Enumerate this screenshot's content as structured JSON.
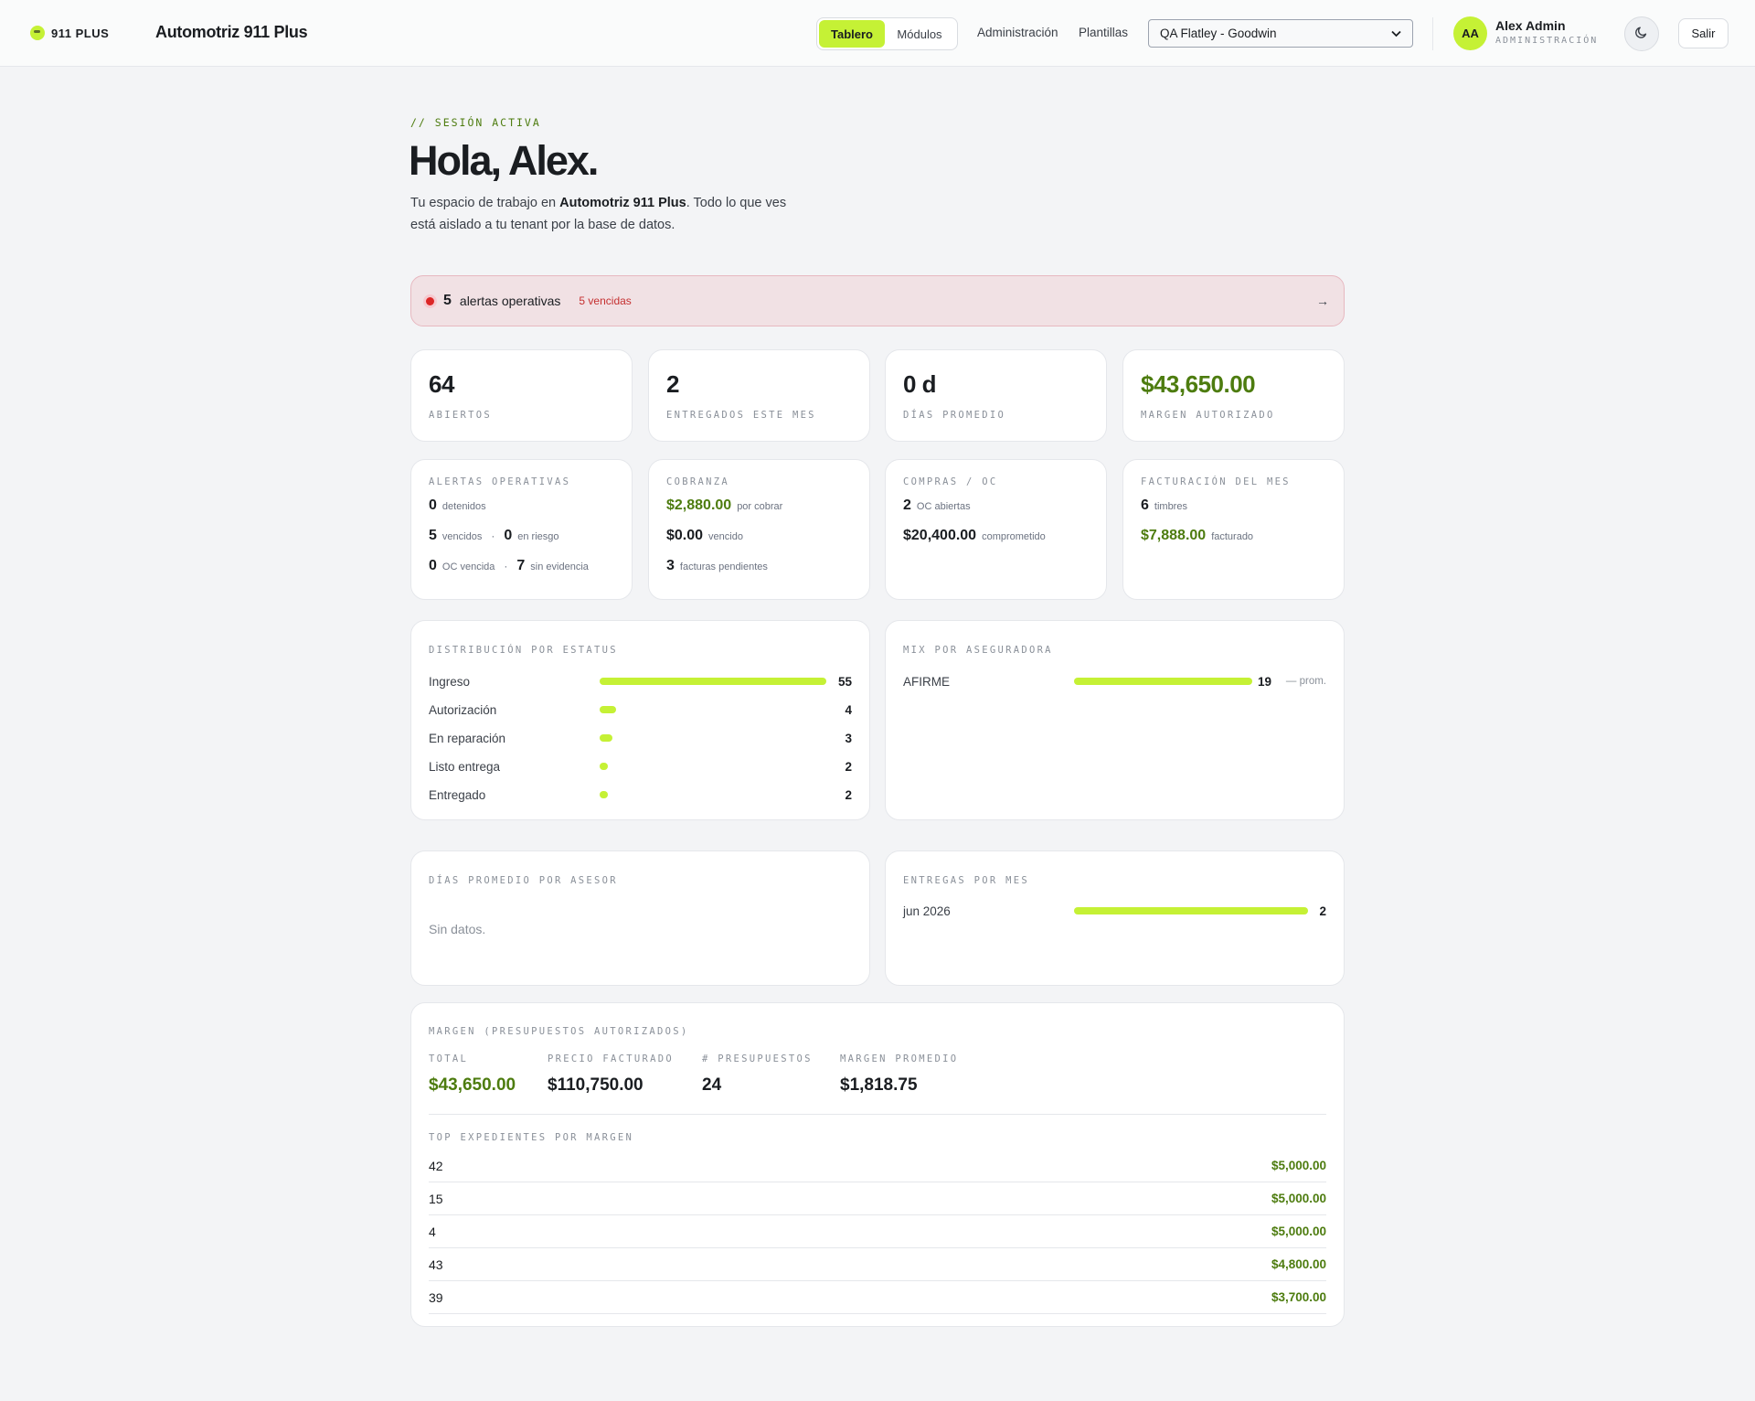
{
  "header": {
    "brand": "911 PLUS",
    "app_title": "Automotriz 911 Plus",
    "tabs": [
      {
        "label": "Tablero",
        "active": true
      },
      {
        "label": "Módulos",
        "active": false
      }
    ],
    "nav": [
      "Administración",
      "Plantillas"
    ],
    "tenant_select": "QA Flatley - Goodwin",
    "user": {
      "initials": "AA",
      "name": "Alex Admin",
      "role": "ADMINISTRACIÓN"
    },
    "theme_icon": "moon-icon",
    "logout": "Salir"
  },
  "hero": {
    "eyebrow": "// SESIÓN ACTIVA",
    "greeting": "Hola, Alex.",
    "intro_prefix": "Tu espacio de trabajo en ",
    "intro_bold": "Automotriz 911 Plus",
    "intro_suffix": ". Todo lo que ves está aislado a tu tenant por la base de datos."
  },
  "alert_banner": {
    "count": "5",
    "label": "alertas operativas",
    "overdue": "5 vencidas",
    "arrow": "→"
  },
  "kpis": [
    {
      "value": "64",
      "label": "ABIERTOS"
    },
    {
      "value": "2",
      "label": "ENTREGADOS ESTE MES"
    },
    {
      "value": "0 d",
      "label": "DÍAS PROMEDIO"
    },
    {
      "value": "$43,650.00",
      "label": "MARGEN AUTORIZADO"
    }
  ],
  "ops_alerts": {
    "title": "ALERTAS OPERATIVAS",
    "detenidos": {
      "n": "0",
      "t": "detenidos"
    },
    "vencidos": {
      "n": "5",
      "t": "vencidos"
    },
    "en_riesgo": {
      "n": "0",
      "t": "en riesgo"
    },
    "oc_vencida": {
      "n": "0",
      "t": "OC vencida"
    },
    "sin_evidencia": {
      "n": "7",
      "t": "sin evidencia"
    },
    "sep": "·"
  },
  "cobranza": {
    "title": "COBRANZA",
    "por_cobrar": {
      "n": "$2,880.00",
      "t": "por cobrar"
    },
    "vencido": {
      "n": "$0.00",
      "t": "vencido"
    },
    "facturas": {
      "n": "3",
      "t": "facturas pendientes"
    }
  },
  "compras": {
    "title": "COMPRAS / OC",
    "abiertas": {
      "n": "2",
      "t": "OC abiertas"
    },
    "comprometido": {
      "n": "$20,400.00",
      "t": "comprometido"
    }
  },
  "facturacion": {
    "title": "FACTURACIÓN DEL MES",
    "timbres": {
      "n": "6",
      "t": "timbres"
    },
    "facturado": {
      "n": "$7,888.00",
      "t": "facturado"
    }
  },
  "distribucion": {
    "title": "DISTRIBUCIÓN POR ESTATUS",
    "rows": [
      {
        "label": "Ingreso",
        "value": 55
      },
      {
        "label": "Autorización",
        "value": 4
      },
      {
        "label": "En reparación",
        "value": 3
      },
      {
        "label": "Listo entrega",
        "value": 2
      },
      {
        "label": "Entregado",
        "value": 2
      }
    ]
  },
  "mix": {
    "title": "MIX POR ASEGURADORA",
    "rows": [
      {
        "label": "AFIRME",
        "value": 19,
        "note": "— prom."
      }
    ]
  },
  "dias_asesor": {
    "title": "DÍAS PROMEDIO POR ASESOR",
    "empty": "Sin datos."
  },
  "entregas": {
    "title": "ENTREGAS POR MES",
    "rows": [
      {
        "label": "jun 2026",
        "value": 2
      }
    ]
  },
  "margen": {
    "title": "MARGEN (PRESUPUESTOS AUTORIZADOS)",
    "stats": [
      {
        "k": "TOTAL",
        "v": "$43,650.00"
      },
      {
        "k": "PRECIO FACTURADO",
        "v": "$110,750.00"
      },
      {
        "k": "# PRESUPUESTOS",
        "v": "24"
      },
      {
        "k": "MARGEN PROMEDIO",
        "v": "$1,818.75"
      }
    ],
    "top_title": "TOP EXPEDIENTES POR MARGEN",
    "top": [
      {
        "id": "42",
        "amount": "$5,000.00"
      },
      {
        "id": "15",
        "amount": "$5,000.00"
      },
      {
        "id": "4",
        "amount": "$5,000.00"
      },
      {
        "id": "43",
        "amount": "$4,800.00"
      },
      {
        "id": "39",
        "amount": "$3,700.00"
      }
    ]
  }
}
